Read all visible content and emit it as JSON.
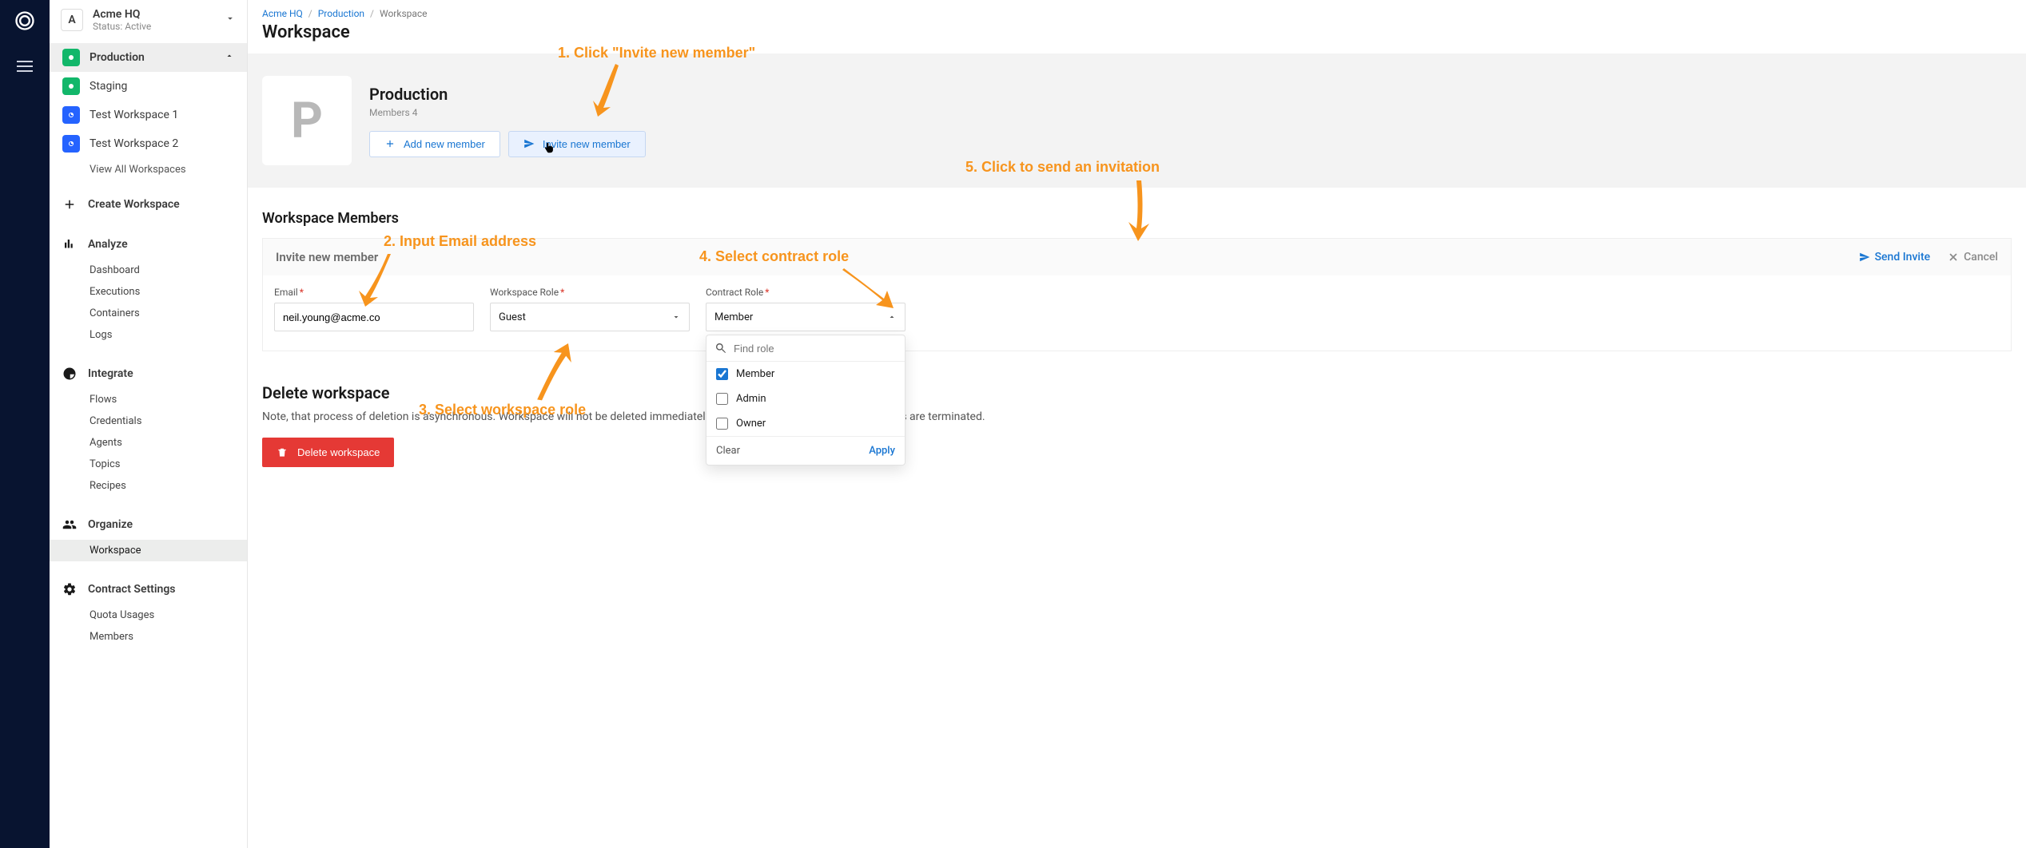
{
  "org": {
    "letter": "A",
    "name": "Acme HQ",
    "status": "Status: Active"
  },
  "workspaces": {
    "items": [
      {
        "label": "Production"
      },
      {
        "label": "Staging"
      },
      {
        "label": "Test Workspace 1"
      },
      {
        "label": "Test Workspace 2"
      }
    ],
    "view_all": "View All Workspaces",
    "create": "Create Workspace"
  },
  "sections": {
    "analyze": {
      "title": "Analyze",
      "items": [
        "Dashboard",
        "Executions",
        "Containers",
        "Logs"
      ]
    },
    "integrate": {
      "title": "Integrate",
      "items": [
        "Flows",
        "Credentials",
        "Agents",
        "Topics",
        "Recipes"
      ]
    },
    "organize": {
      "title": "Organize",
      "items": [
        "Workspace"
      ]
    },
    "contract": {
      "title": "Contract Settings",
      "items": [
        "Quota Usages",
        "Members"
      ]
    }
  },
  "breadcrumbs": {
    "a": "Acme HQ",
    "b": "Production",
    "c": "Workspace"
  },
  "page_title": "Workspace",
  "ws_card": {
    "letter": "P",
    "title": "Production",
    "members_label": "Members 4",
    "add_btn": "Add new member",
    "invite_btn": "Invite new member"
  },
  "members_section": {
    "heading": "Workspace Members",
    "panel_title": "Invite new member",
    "send": "Send Invite",
    "cancel": "Cancel",
    "email_label": "Email",
    "email_value": "neil.young@acme.co",
    "ws_role_label": "Workspace Role",
    "ws_role_value": "Guest",
    "contract_role_label": "Contract Role",
    "contract_role_value": "Member",
    "dd_placeholder": "Find role",
    "dd_options": [
      "Member",
      "Admin",
      "Owner"
    ],
    "dd_clear": "Clear",
    "dd_apply": "Apply"
  },
  "delete_section": {
    "heading": "Delete workspace",
    "note": "Note, that process of deletion is asynchronous. Workspace will not be deleted immediately but after all the active integration flows are terminated.",
    "button": "Delete workspace"
  },
  "annotations": {
    "a1": "1. Click \"Invite new member\"",
    "a2": "2. Input Email address",
    "a3": "3. Select workspace role",
    "a4": "4. Select contract role",
    "a5": "5. Click to send an invitation"
  }
}
